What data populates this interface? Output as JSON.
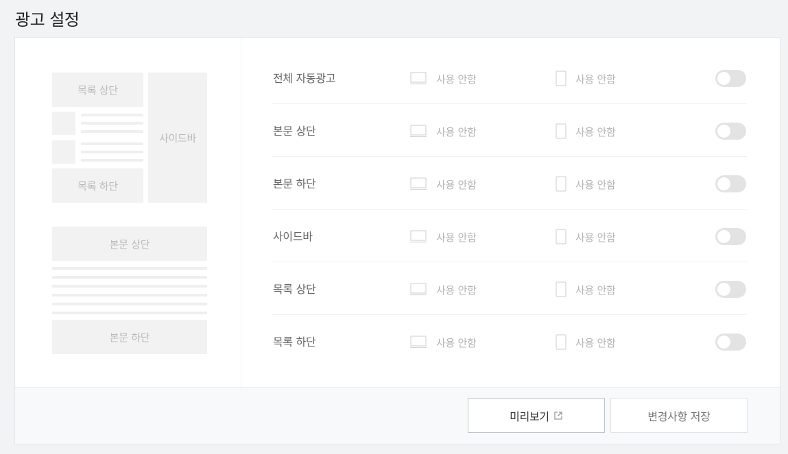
{
  "page": {
    "title": "광고 설정"
  },
  "preview": {
    "list_top": "목록 상단",
    "list_bottom": "목록 하단",
    "sidebar": "사이드바",
    "body_top": "본문 상단",
    "body_bottom": "본문 하단"
  },
  "settings": {
    "rows": [
      {
        "label": "전체 자동광고",
        "pc_status": "사용 안함",
        "mobile_status": "사용 안함",
        "enabled": false
      },
      {
        "label": "본문 상단",
        "pc_status": "사용 안함",
        "mobile_status": "사용 안함",
        "enabled": false
      },
      {
        "label": "본문 하단",
        "pc_status": "사용 안함",
        "mobile_status": "사용 안함",
        "enabled": false
      },
      {
        "label": "사이드바",
        "pc_status": "사용 안함",
        "mobile_status": "사용 안함",
        "enabled": false
      },
      {
        "label": "목록 상단",
        "pc_status": "사용 안함",
        "mobile_status": "사용 안함",
        "enabled": false
      },
      {
        "label": "목록 하단",
        "pc_status": "사용 안함",
        "mobile_status": "사용 안함",
        "enabled": false
      }
    ]
  },
  "footer": {
    "preview_label": "미리보기",
    "save_label": "변경사항 저장"
  },
  "icons": {
    "pc": "monitor-icon",
    "mobile": "phone-icon",
    "external": "external-link-icon"
  },
  "colors": {
    "toggle_off": "#e3e3e3",
    "placeholder_block": "#f2f2f2"
  }
}
